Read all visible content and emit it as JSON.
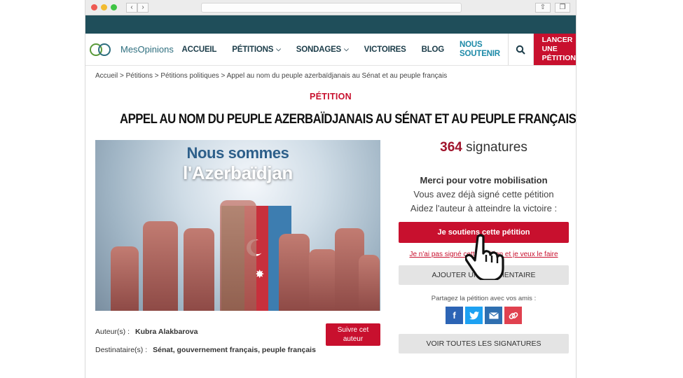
{
  "site": {
    "logo": "MesOpinions"
  },
  "nav": [
    {
      "label": "ACCUEIL",
      "chevron": false
    },
    {
      "label": "PÉTITIONS",
      "chevron": true
    },
    {
      "label": "SONDAGES",
      "chevron": true
    },
    {
      "label": "VICTOIRES",
      "chevron": false
    },
    {
      "label": "BLOG",
      "chevron": false
    }
  ],
  "nav_soutenir": {
    "line1": "NOUS",
    "line2": "SOUTENIR"
  },
  "cta": {
    "line1": "LANCER",
    "line2": "UNE",
    "line3": "PÉTITION"
  },
  "breadcrumb": "Accueil > Pétitions > Pétitions politiques > Appel au nom du peuple azerbaïdjanais au Sénat et au peuple français",
  "kicker": "PÉTITION",
  "title": "APPEL AU NOM DU PEUPLE AZERBAÏDJANAIS AU SÉNAT ET AU PEUPLE FRANÇAIS",
  "hero": {
    "line1": "Nous sommes",
    "line2": "l'Azerbaïdjan"
  },
  "author": {
    "label": "Auteur(s) :",
    "value": "Kubra Alakbarova"
  },
  "recipient": {
    "label": "Destinataire(s) :",
    "value": "Sénat, gouvernement français, peuple français"
  },
  "follow_button": {
    "line1": "Suivre cet",
    "line2": "auteur"
  },
  "signatures": {
    "count": "364",
    "label": "signatures"
  },
  "thanks": "Merci pour votre mobilisation",
  "already_signed": "Vous avez déjà signé cette pétition",
  "help_author": "Aidez l'auteur à atteindre la victoire :",
  "support_button": "Je soutiens cette pétition",
  "not_signed_link": "Je n'ai pas signé cette pétition et je veux le faire",
  "comment_button": "AJOUTER UN COMMENTAIRE",
  "share_label": "Partagez la pétition avec vos amis :",
  "share_icons": [
    "facebook-icon",
    "twitter-icon",
    "mail-icon",
    "link-icon"
  ],
  "all_signatures_button": "VOIR TOUTES LES SIGNATURES",
  "colors": {
    "accent": "#c8102e",
    "topbar": "#1f4e5a",
    "nav": "#1b3c49"
  }
}
